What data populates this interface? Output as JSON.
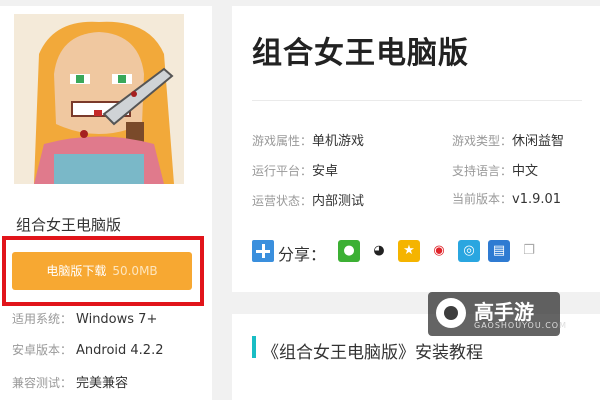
{
  "app": {
    "name": "组合女王电脑版",
    "title": "组合女王电脑版"
  },
  "download": {
    "label": "电脑版下载",
    "size": "50.0MB"
  },
  "specs": [
    {
      "label": "适用系统：",
      "value": "Windows 7+"
    },
    {
      "label": "安卓版本：",
      "value": "Android 4.2.2"
    },
    {
      "label": "兼容测试：",
      "value": "完美兼容"
    }
  ],
  "attributes": {
    "game_attr": {
      "label": "游戏属性：",
      "value": "单机游戏"
    },
    "game_type": {
      "label": "游戏类型：",
      "value": "休闲益智"
    },
    "platform": {
      "label": "运行平台：",
      "value": "安卓"
    },
    "language": {
      "label": "支持语言：",
      "value": "中文"
    },
    "status": {
      "label": "运营状态：",
      "value": "内部测试"
    },
    "version": {
      "label": "当前版本：",
      "value": "v1.9.01"
    }
  },
  "share": {
    "label": "分享：",
    "icons": [
      "wechat-icon",
      "qq-icon",
      "qzone-icon",
      "weibo-icon",
      "tencent-weibo-icon",
      "print-icon",
      "copy-icon"
    ]
  },
  "tutorial": {
    "title": "《组合女王电脑版》安装教程"
  },
  "watermark": {
    "brand": "高手游",
    "domain": "GAOSHOUYOU.COM"
  },
  "colors": {
    "download_button": "#f7a832",
    "highlight_frame": "#e1141a",
    "tutorial_accent": "#19bdc4",
    "share_blue": "#3a8fdd"
  }
}
